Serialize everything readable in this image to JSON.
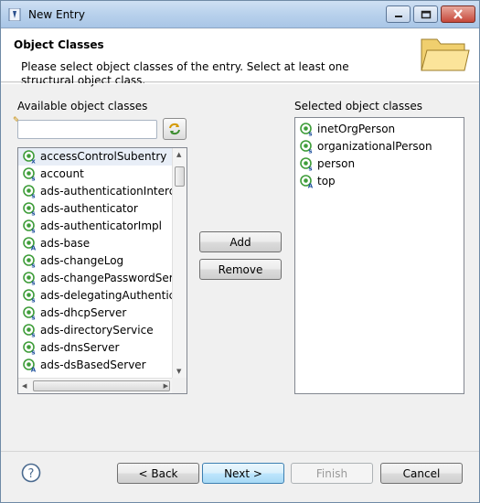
{
  "window": {
    "title": "New Entry"
  },
  "banner": {
    "title": "Object Classes",
    "description": "Please select object classes of the entry. Select at least one structural object class."
  },
  "available": {
    "label": "Available object classes",
    "search_value": "",
    "items": [
      {
        "name": "accessControlSubentry",
        "icon": "auxiliary-class-icon",
        "selected": true
      },
      {
        "name": "account",
        "icon": "structural-class-icon"
      },
      {
        "name": "ads-authenticationIntercep",
        "icon": "structural-class-icon"
      },
      {
        "name": "ads-authenticator",
        "icon": "structural-class-icon"
      },
      {
        "name": "ads-authenticatorImpl",
        "icon": "structural-class-icon"
      },
      {
        "name": "ads-base",
        "icon": "abstract-class-icon"
      },
      {
        "name": "ads-changeLog",
        "icon": "structural-class-icon"
      },
      {
        "name": "ads-changePasswordServer",
        "icon": "structural-class-icon"
      },
      {
        "name": "ads-delegatingAuthenticato",
        "icon": "structural-class-icon"
      },
      {
        "name": "ads-dhcpServer",
        "icon": "structural-class-icon"
      },
      {
        "name": "ads-directoryService",
        "icon": "structural-class-icon"
      },
      {
        "name": "ads-dnsServer",
        "icon": "structural-class-icon"
      },
      {
        "name": "ads-dsBasedServer",
        "icon": "abstract-class-icon"
      }
    ]
  },
  "selected": {
    "label": "Selected object classes",
    "items": [
      {
        "name": "inetOrgPerson",
        "icon": "structural-class-icon"
      },
      {
        "name": "organizationalPerson",
        "icon": "structural-class-icon"
      },
      {
        "name": "person",
        "icon": "structural-class-icon"
      },
      {
        "name": "top",
        "icon": "abstract-class-icon"
      }
    ]
  },
  "buttons": {
    "add": "Add",
    "remove": "Remove",
    "back": "< Back",
    "next": "Next >",
    "finish": "Finish",
    "cancel": "Cancel"
  },
  "colors": {
    "icon_green": "#3f9d3a",
    "primary_border": "#3c7fb1"
  }
}
